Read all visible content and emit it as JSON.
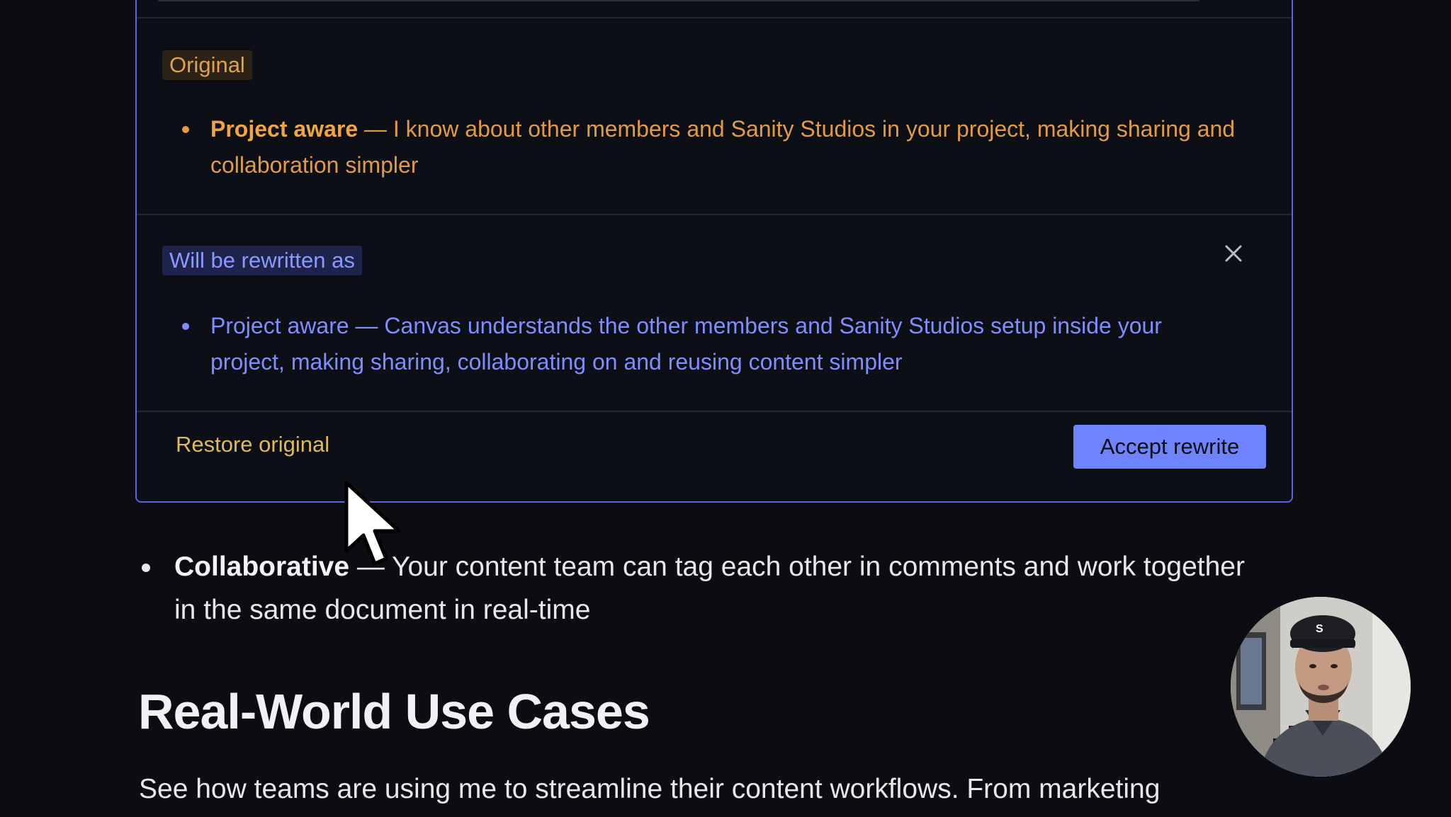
{
  "rewrite_card": {
    "original_badge": "Original",
    "original_bold": "Project aware",
    "original_text": " — I know about other members and Sanity Studios in your project, making sharing and collaboration simpler",
    "rewrite_badge": "Will be rewritten as",
    "rewrite_text": "Project aware — Canvas understands the other members and Sanity Studios setup inside your project, making sharing, collaborating on and reusing content simpler",
    "close_icon": "close-icon",
    "restore_label": "Restore original",
    "accept_label": "Accept rewrite",
    "colors": {
      "border": "#5a66e0",
      "original": "#e39b43",
      "rewrite": "#7f8dff",
      "accept_bg": "#6e84ff"
    }
  },
  "document": {
    "bullet_bold": "Collaborative",
    "bullet_text": " — Your content team can tag each other in comments and work together in the same document in real-time",
    "section_heading": "Real-World Use Cases",
    "section_paragraph": "See how teams are using me to streamline their content workflows.  From marketing"
  },
  "overlay": {
    "cursor_icon": "mouse-pointer-icon",
    "webcam": "presenter-webcam"
  }
}
